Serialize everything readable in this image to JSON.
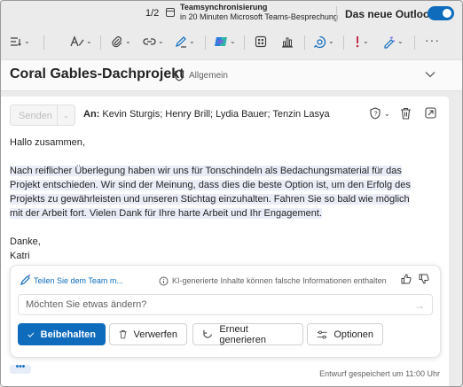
{
  "notification": {
    "pager": "1/2",
    "reminder_title": "Teamsynchronisierung",
    "reminder_detail": "in 20 Minuten Microsoft Teams-Besprechung",
    "new_outlook_label": "Das neue Outlook",
    "toggle_on": true
  },
  "toolbar": {
    "icons": [
      "list-format-icon",
      "text-style-icon",
      "attach-icon",
      "link-icon",
      "signature-icon",
      "copilot-icon",
      "apps-icon",
      "chart-icon",
      "loop-icon",
      "priority-icon",
      "sensitivity-icon",
      "more-icon"
    ]
  },
  "subject": {
    "title": "Coral Gables-Dachprojekt",
    "category": "Allgemein"
  },
  "compose": {
    "send_label": "Senden",
    "to_label": "An:",
    "recipients": "Kevin Sturgis; Henry Brill; Lydia Bauer; Tenzin Lasya",
    "greeting": "Hallo zusammen,",
    "body": "Nach reiflicher Überlegung haben wir uns für Tonschindeln als Bedachungsmaterial für das Projekt entschieden. Wir sind der Meinung, dass dies die beste Option ist, um den Erfolg des Projekts zu gewährleisten und unseren Stichtag einzuhalten. Fahren Sie so bald wie möglich mit der Arbeit fort. Vielen Dank für Ihre harte Arbeit und Ihr Engagement.",
    "closing": "Danke,",
    "signature": "Katri"
  },
  "copilot": {
    "title": "Teilen Sie dem Team m...",
    "disclaimer": "KI-generierte Inhalte können falsche Informationen enthalten",
    "input_placeholder": "Möchten Sie etwas ändern?",
    "keep_label": "Beibehalten",
    "discard_label": "Verwerfen",
    "regenerate_label": "Erneut generieren",
    "options_label": "Optionen"
  },
  "footer": {
    "more_label": "•••",
    "draft_status": "Entwurf gespeichert um 11:00 Uhr"
  },
  "colors": {
    "accent": "#0f6cbd",
    "highlight": "#eaedf8"
  }
}
